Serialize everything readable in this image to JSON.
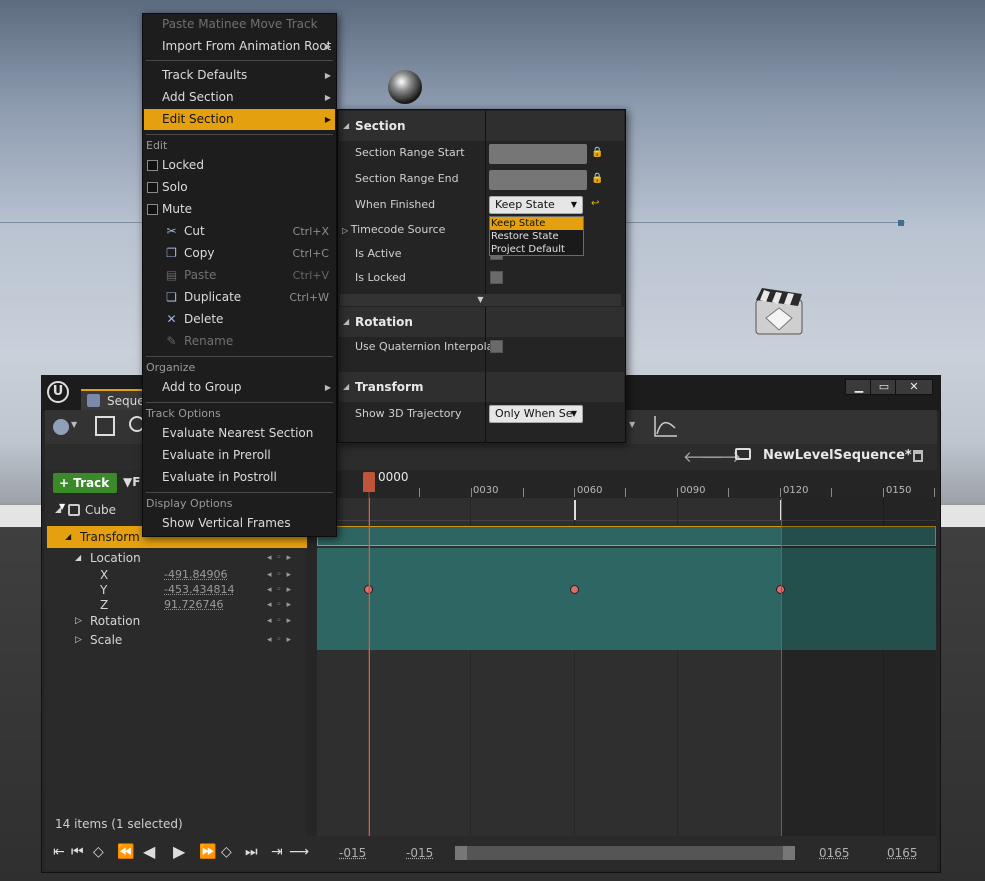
{
  "context_menu": {
    "paste_matinee": "Paste Matinee Move Track",
    "import_anim_root": "Import From Animation Root",
    "track_defaults": "Track Defaults",
    "add_section": "Add Section",
    "edit_section": "Edit Section",
    "edit_header": "Edit",
    "locked": "Locked",
    "solo": "Solo",
    "mute": "Mute",
    "cut": "Cut",
    "cut_sc": "Ctrl+X",
    "copy": "Copy",
    "copy_sc": "Ctrl+C",
    "paste": "Paste",
    "paste_sc": "Ctrl+V",
    "duplicate": "Duplicate",
    "duplicate_sc": "Ctrl+W",
    "delete": "Delete",
    "rename": "Rename",
    "organize_header": "Organize",
    "add_to_group": "Add to Group",
    "track_options_header": "Track Options",
    "eval_nearest": "Evaluate Nearest Section",
    "eval_preroll": "Evaluate in Preroll",
    "eval_postroll": "Evaluate in Postroll",
    "display_options_header": "Display Options",
    "show_vertical_frames": "Show Vertical Frames"
  },
  "section_panel": {
    "section_cat": "Section",
    "range_start": "Section Range Start",
    "range_end": "Section Range End",
    "when_finished": "When Finished",
    "when_finished_value": "Keep State",
    "timecode_source": "Timecode Source",
    "is_active": "Is Active",
    "is_locked": "Is Locked",
    "rotation_cat": "Rotation",
    "use_quaternion": "Use Quaternion Interpolati",
    "transform_cat": "Transform",
    "show_3d_traj": "Show 3D Trajectory",
    "show_3d_traj_value": "Only When Se",
    "dropdown_options": [
      "Keep State",
      "Restore State",
      "Project Default"
    ]
  },
  "sequencer": {
    "tab_label": "Seque",
    "sequence_name": "NewLevelSequence*",
    "add_track_label": "Track",
    "filter_label": "F",
    "items_status": "14 items (1 selected)",
    "tree": {
      "cube": "Cube",
      "transform": "Transform",
      "location": "Location",
      "x_label": "X",
      "x_value": "-491.84906",
      "y_label": "Y",
      "y_value": "-453.434814",
      "z_label": "Z",
      "z_value": "91.726746",
      "rotation": "Rotation",
      "scale": "Scale"
    },
    "ruler": {
      "current": "0000",
      "labels": [
        "0030",
        "0060",
        "0090",
        "0120",
        "0150"
      ]
    },
    "range": {
      "view_start": "-015",
      "work_start": "-015",
      "work_end": "0165",
      "view_end": "0165"
    }
  },
  "colors": {
    "highlight": "#e5a00f",
    "section_band": "#2e6461",
    "key": "#e06b6b"
  }
}
